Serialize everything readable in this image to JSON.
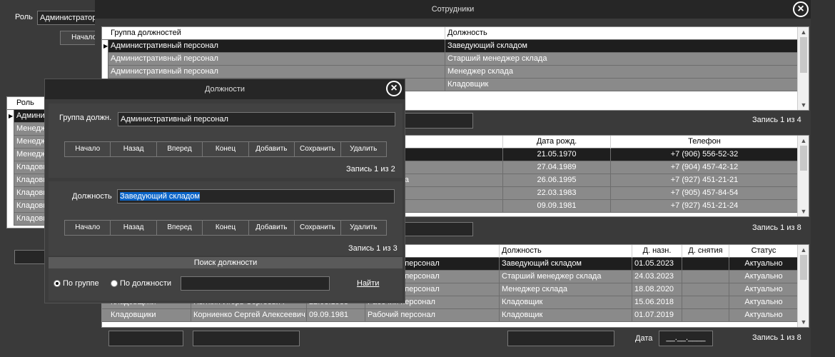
{
  "bg": {
    "role_label": "Роль",
    "role_value": "Администратор",
    "start_btn": "Начало",
    "grid_header": "Роль",
    "grid_rows": [
      "Админист",
      "Менеджер",
      "Менеджер",
      "Менеджер",
      "Кладовщ",
      "Кладовщ",
      "Кладовщ",
      "Кладовщ",
      "Кладовщ"
    ]
  },
  "employees": {
    "title": "Сотрудники",
    "grid1": {
      "headers": [
        "Группа должностей",
        "Должность"
      ],
      "rows": [
        [
          "Административный персонал",
          "Заведующий складом"
        ],
        [
          "Административный персонал",
          "Старший менеджер склада"
        ],
        [
          "Административный персонал",
          "Менеджер склада"
        ],
        [
          "Административный персонал",
          "Кладовщик"
        ]
      ],
      "record": "Запись 1 из 4"
    },
    "grid2": {
      "headers": [
        "Дата рожд.",
        "Телефон"
      ],
      "rows": [
        [
          "а",
          "21.05.1970",
          "+7 (906) 556-52-32"
        ],
        [
          "",
          "27.04.1989",
          "+7 (904) 457-42-12"
        ],
        [
          "вна",
          "26.06.1995",
          "+7 (927) 451-21-21"
        ],
        [
          "",
          "22.03.1983",
          "+7 (905) 457-84-54"
        ],
        [
          "ич",
          "09.09.1981",
          "+7 (927) 451-21-24"
        ]
      ],
      "record": "Запись 1 из 8"
    },
    "grid3": {
      "headers": [
        "лжностей",
        "Должность",
        "Д. назн.",
        "Д. снятия",
        "Статус"
      ],
      "rows": [
        [
          "",
          "",
          "",
          "ративный персонал",
          "Заведующий складом",
          "01.05.2023",
          "",
          "Актуально"
        ],
        [
          "",
          "",
          "",
          "ративный персонал",
          "Старший менеджер склада",
          "24.03.2023",
          "",
          "Актуально"
        ],
        [
          "",
          "",
          "",
          "ративный персонал",
          "Менеджер склада",
          "18.08.2020",
          "",
          "Актуально"
        ],
        [
          "Кладовщики",
          "Пыткин Игорь Сергеевич",
          "22.03.1983",
          "Рабочий персонал",
          "Кладовщик",
          "15.06.2018",
          "",
          "Актуально"
        ],
        [
          "Кладовщики",
          "Корниенко Сергей Алексеевич",
          "09.09.1981",
          "Рабочий персонал",
          "Кладовщик",
          "01.07.2019",
          "",
          "Актуально"
        ]
      ],
      "date_label": "Дата",
      "date_mask": "__.__.____",
      "record": "Запись 1 из 8"
    }
  },
  "positions": {
    "title": "Должности",
    "group_label": "Группа должн.",
    "group_value": "Административный персонал",
    "nav1": [
      "Начало",
      "Назад",
      "Вперед",
      "Конец",
      "Добавить",
      "Сохранить",
      "Удалить"
    ],
    "record1": "Запись 1 из 2",
    "position_label": "Должность",
    "position_value": "Заведующий складом",
    "nav2": [
      "Начало",
      "Назад",
      "Вперед",
      "Конец",
      "Добавить",
      "Сохранить",
      "Удалить"
    ],
    "record2": "Запись 1 из 3",
    "search_title": "Поиск должности",
    "radio_group": "По группе",
    "radio_position": "По должности",
    "find_link": "Найти"
  },
  "colors": {
    "selected_row": "#1e1e1e",
    "row": "#8a8a8a",
    "highlight": "#0a64c8"
  }
}
